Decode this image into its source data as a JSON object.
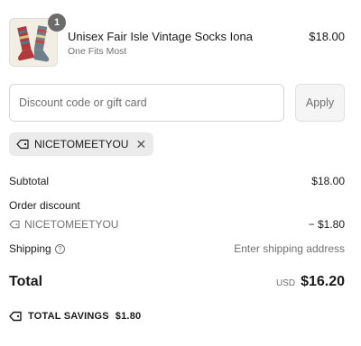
{
  "product": {
    "quantity": "1",
    "name": "Unisex Fair Isle Vintage Socks Iona",
    "variant": "One Fits Most",
    "price": "$18.00"
  },
  "discount": {
    "placeholder": "Discount code or gift card",
    "value": "",
    "apply_label": "Apply"
  },
  "applied_code": {
    "code": "NICETOMEETYOU",
    "remove_symbol": "✕"
  },
  "summary": {
    "subtotal_label": "Subtotal",
    "subtotal_value": "$18.00",
    "order_discount_label": "Order discount",
    "discount_code": "NICETOMEETYOU",
    "discount_value": "− $1.80",
    "shipping_label": "Shipping",
    "shipping_help_symbol": "?",
    "shipping_value": "Enter shipping address",
    "total_label": "Total",
    "currency": "USD",
    "total_value": "$16.20",
    "savings_label": "TOTAL SAVINGS",
    "savings_value": "$1.80"
  },
  "icons": {
    "tag": "tag-icon",
    "help": "question-circle-icon",
    "close": "close-icon"
  }
}
